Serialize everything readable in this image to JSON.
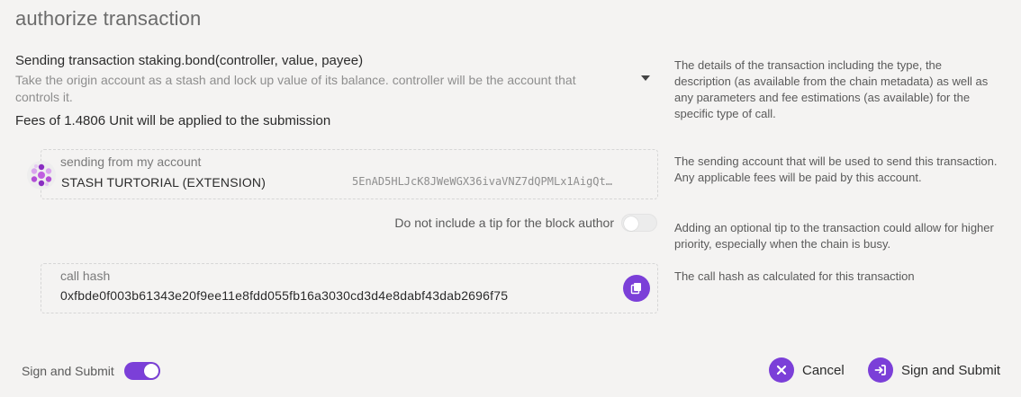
{
  "page_title": "authorize transaction",
  "transaction": {
    "title": "Sending transaction staking.bond(controller, value, payee)",
    "description": "Take the origin account as a stash and lock up value of its balance. controller will be the account that controls it.",
    "fees": "Fees of 1.4806 Unit will be applied to the submission",
    "help": "The details of the transaction including the type, the description (as available from the chain metadata) as well as any parameters and fee estimations (as available) for the specific type of call."
  },
  "account": {
    "label": "sending from my account",
    "name": "STASH TURTORIAL (EXTENSION)",
    "address": "5EnAD5HLJcK8JWeWGX36ivaVNZ7dQPMLx1AigQt…",
    "help": "The sending account that will be used to send this transaction. Any applicable fees will be paid by this account."
  },
  "tip": {
    "label": "Do not include a tip for the block author",
    "enabled": false,
    "help": "Adding an optional tip to the transaction could allow for higher priority, especially when the chain is busy."
  },
  "call_hash": {
    "label": "call hash",
    "value": "0xfbde0f003b61343e20f9ee11e8fdd055fb16a3030cd3d4e8dabf43dab2696f75",
    "help": "The call hash as calculated for this transaction"
  },
  "footer": {
    "sign_toggle_label": "Sign and Submit",
    "sign_toggle_enabled": true,
    "cancel_label": "Cancel",
    "submit_label": "Sign and Submit"
  },
  "colors": {
    "accent": "#7b3fd8",
    "background": "#f4f3f2"
  },
  "icons": {
    "expand": "chevron-down-icon",
    "copy": "copy-icon",
    "cancel": "close-icon",
    "submit": "sign-in-icon",
    "avatar": "identicon"
  }
}
